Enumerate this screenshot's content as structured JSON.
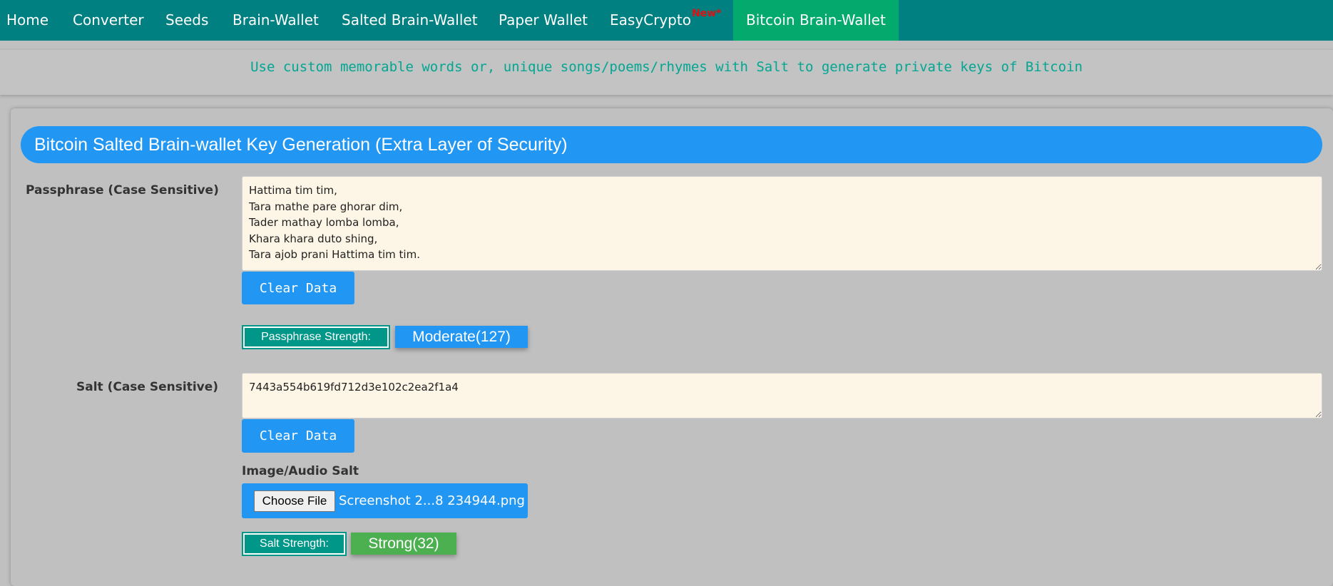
{
  "nav": {
    "items": [
      {
        "label": "Home"
      },
      {
        "label": "Converter"
      },
      {
        "label": "Seeds"
      },
      {
        "label": "Brain-Wallet"
      },
      {
        "label": "Salted Brain-Wallet"
      },
      {
        "label": "Paper Wallet"
      },
      {
        "label": "EasyCrypto",
        "badge": "New*"
      },
      {
        "label": "Bitcoin Brain-Wallet"
      }
    ],
    "active_label": "Bitcoin Brain-Wallet"
  },
  "banner": {
    "text": "Use custom memorable words or, unique songs/poems/rhymes with Salt to generate private keys of Bitcoin"
  },
  "card": {
    "title": "Bitcoin Salted Brain-wallet Key Generation (Extra Layer of Security)"
  },
  "passphrase": {
    "label": "Passphrase (Case Sensitive)",
    "value": "Hattima tim tim,\nTara mathe pare ghorar dim,\nTader mathay lomba lomba,\nKhara khara duto shing,\nTara ajob prani Hattima tim tim.",
    "clear_label": "Clear Data",
    "strength_label": "Passphrase Strength:",
    "strength_value": "Moderate(127)"
  },
  "salt": {
    "label": "Salt (Case Sensitive)",
    "value": "7443a554b619fd712d3e102c2ea2f1a4",
    "clear_label": "Clear Data",
    "media_label": "Image/Audio Salt",
    "file_button_label": "Choose File",
    "file_name": "Screenshot 2...8 234944.png",
    "strength_label": "Salt Strength:",
    "strength_value": "Strong(32)"
  },
  "colors": {
    "nav_bg": "#008080",
    "nav_active": "#04aa6d",
    "primary_blue": "#2196f3",
    "teal": "#009688",
    "strong_green": "#4caf50",
    "textarea_bg": "#fdf5e6",
    "badge_red": "#e01010"
  }
}
